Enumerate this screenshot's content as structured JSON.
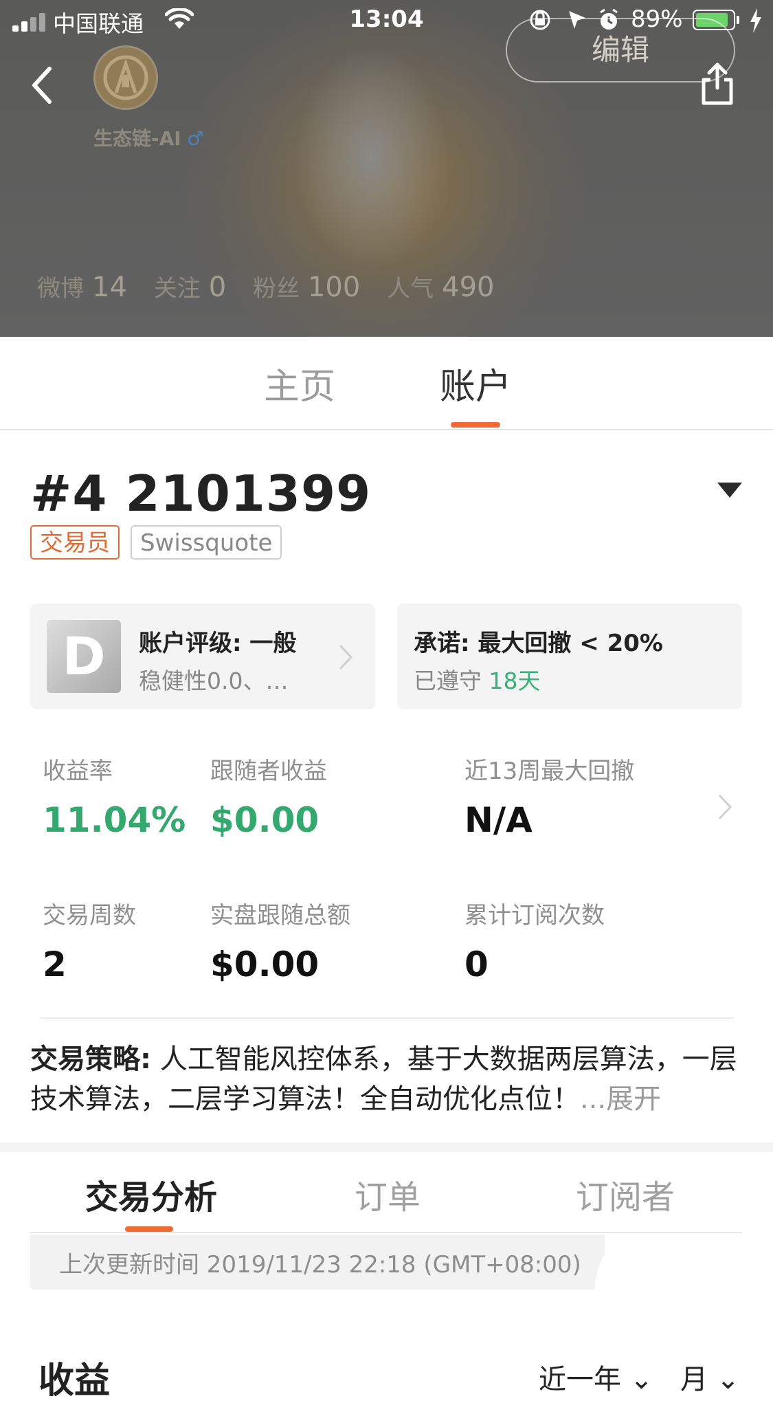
{
  "status_bar": {
    "carrier": "中国联通",
    "time": "13:04",
    "battery_percent": "89%",
    "battery_level": 0.89
  },
  "header": {
    "username": "生态链-AI",
    "gender_symbol": "♂",
    "edit_label": "编辑",
    "stats": [
      {
        "label": "微博",
        "value": "14"
      },
      {
        "label": "关注",
        "value": "0"
      },
      {
        "label": "粉丝",
        "value": "100"
      },
      {
        "label": "人气",
        "value": "490"
      }
    ]
  },
  "main_tabs": [
    {
      "label": "主页",
      "active": false
    },
    {
      "label": "账户",
      "active": true
    }
  ],
  "account": {
    "title": "#4 2101399",
    "role_tag": "交易员",
    "broker_tag": "Swissquote",
    "rating": {
      "badge": "D",
      "title": "账户评级: 一般",
      "subtitle": "稳健性0.0、…"
    },
    "promise": {
      "title": "承诺: 最大回撤 < 20%",
      "kept_prefix": "已遵守",
      "kept_days": "18天"
    },
    "metrics": [
      {
        "label": "收益率",
        "value": "11.04%"
      },
      {
        "label": "跟随者收益",
        "value": "$0.00"
      },
      {
        "label": "近13周最大回撤",
        "value": "N/A"
      },
      {
        "label": "交易周数",
        "value": "2"
      },
      {
        "label": "实盘跟随总额",
        "value": "$0.00"
      },
      {
        "label": "累计订阅次数",
        "value": "0"
      }
    ],
    "strategy": {
      "label": "交易策略:",
      "text": " 人工智能风控体系，基于大数据两层算法，一层技术算法，二层学习算法！全自动优化点位！",
      "expand": "...展开"
    }
  },
  "sub_tabs": [
    {
      "label": "交易分析",
      "active": true
    },
    {
      "label": "订单",
      "active": false
    },
    {
      "label": "订阅者",
      "active": false
    }
  ],
  "update_time": "上次更新时间 2019/11/23 22:18 (GMT+08:00)",
  "income": {
    "title": "收益",
    "period_filter": "近一年",
    "unit_filter": "月"
  },
  "colors": {
    "accent": "#ee6b34",
    "positive": "#34a86f"
  }
}
